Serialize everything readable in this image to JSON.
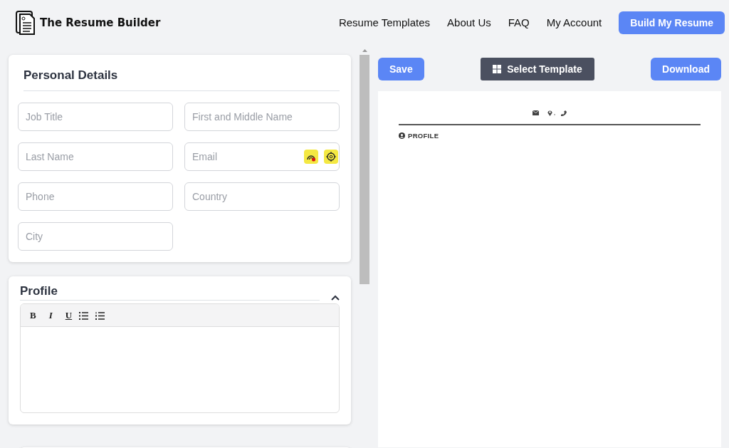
{
  "header": {
    "brand": "The Resume Builder",
    "nav": [
      {
        "label": "Resume Templates"
      },
      {
        "label": "About Us"
      },
      {
        "label": "FAQ"
      },
      {
        "label": "My Account"
      }
    ],
    "cta": "Build My Resume"
  },
  "personal_details": {
    "title": "Personal Details",
    "fields": [
      {
        "kind": "plain",
        "placeholder": "Job Title"
      },
      {
        "kind": "plain",
        "placeholder": "First and Middle Name"
      },
      {
        "kind": "plain",
        "placeholder": "Last Name"
      },
      {
        "kind": "extensions",
        "placeholder": "Email"
      },
      {
        "kind": "plain",
        "placeholder": "Phone"
      },
      {
        "kind": "plain",
        "placeholder": "Country"
      },
      {
        "kind": "plain",
        "placeholder": "City"
      }
    ]
  },
  "profile": {
    "title": "Profile",
    "expanded": true,
    "toolbar": [
      {
        "kind": "bold",
        "label": "B"
      },
      {
        "kind": "italic",
        "label": "I"
      },
      {
        "kind": "underline",
        "label": "U"
      },
      {
        "kind": "bullets"
      },
      {
        "kind": "numbers"
      }
    ]
  },
  "preview_toolbar": {
    "save": "Save",
    "select_template": "Select Template",
    "download": "Download"
  },
  "preview": {
    "contact_separator": ",",
    "section_title": "PROFILE"
  }
}
